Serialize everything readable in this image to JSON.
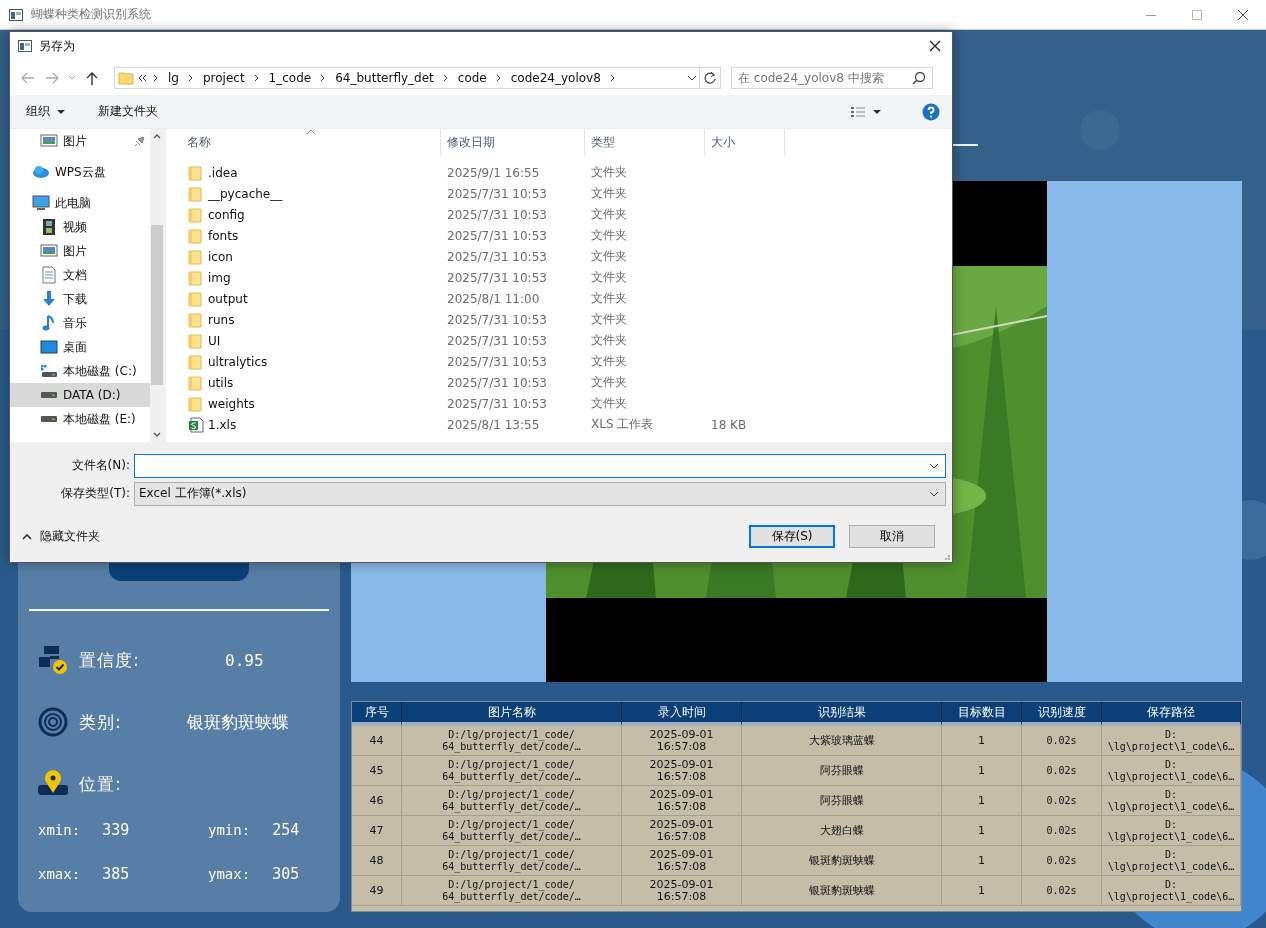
{
  "app": {
    "title": "蝴蝶种类检测识别系统"
  },
  "results": {
    "confidence_label": "置信度:",
    "confidence": "0.95",
    "class_label": "类别:",
    "class": "银斑豹斑蛱蝶",
    "position_label": "位置:",
    "coords": [
      {
        "label": "xmin:",
        "value": "339"
      },
      {
        "label": "ymin:",
        "value": "254"
      },
      {
        "label": "xmax:",
        "value": "385"
      },
      {
        "label": "ymax:",
        "value": "305"
      }
    ]
  },
  "table": {
    "columns": [
      "序号",
      "图片名称",
      "录入时间",
      "识别结果",
      "目标数目",
      "识别速度",
      "保存路径"
    ],
    "rows": [
      [
        "44",
        "D:/lg/project/1_code/\n64_butterfly_det/code/…",
        "2025-09-01\n16:57:08",
        "大紫玻璃蓝蝶",
        "1",
        "0.02s",
        "D:\n\\lg\\project\\1_code\\6…"
      ],
      [
        "45",
        "D:/lg/project/1_code/\n64_butterfly_det/code/…",
        "2025-09-01\n16:57:08",
        "阿芬眼蝶",
        "1",
        "0.02s",
        "D:\n\\lg\\project\\1_code\\6…"
      ],
      [
        "46",
        "D:/lg/project/1_code/\n64_butterfly_det/code/…",
        "2025-09-01\n16:57:08",
        "阿芬眼蝶",
        "1",
        "0.02s",
        "D:\n\\lg\\project\\1_code\\6…"
      ],
      [
        "47",
        "D:/lg/project/1_code/\n64_butterfly_det/code/…",
        "2025-09-01\n16:57:08",
        "大翅白蝶",
        "1",
        "0.02s",
        "D:\n\\lg\\project\\1_code\\6…"
      ],
      [
        "48",
        "D:/lg/project/1_code/\n64_butterfly_det/code/…",
        "2025-09-01\n16:57:08",
        "银斑豹斑蛱蝶",
        "1",
        "0.02s",
        "D:\n\\lg\\project\\1_code\\6…"
      ],
      [
        "49",
        "D:/lg/project/1_code/\n64_butterfly_det/code/…",
        "2025-09-01\n16:57:08",
        "银斑豹斑蛱蝶",
        "1",
        "0.02s",
        "D:\n\\lg\\project\\1_code\\6…"
      ]
    ]
  },
  "dialog": {
    "title": "另存为",
    "address": {
      "path": [
        "lg",
        "project",
        "1_code",
        "64_butterfly_det",
        "code",
        "code24_yolov8"
      ]
    },
    "search": {
      "placeholder": "在 code24_yolov8 中搜索"
    },
    "toolbar": {
      "organize": "组织",
      "new_folder": "新建文件夹"
    },
    "nav": [
      {
        "label": "图片",
        "kind": "pictures",
        "pinned": true,
        "selected": false
      },
      {
        "label": "WPS云盘",
        "kind": "cloud",
        "pinned": false,
        "selected": false
      },
      {
        "label": "此电脑",
        "kind": "pc",
        "pinned": false,
        "selected": false,
        "children": [
          {
            "label": "视频",
            "kind": "video",
            "selected": false
          },
          {
            "label": "图片",
            "kind": "pictures",
            "selected": false
          },
          {
            "label": "文档",
            "kind": "docs",
            "selected": false
          },
          {
            "label": "下载",
            "kind": "download",
            "selected": false
          },
          {
            "label": "音乐",
            "kind": "music",
            "selected": false
          },
          {
            "label": "桌面",
            "kind": "desktop",
            "selected": false
          },
          {
            "label": "本地磁盘 (C:)",
            "kind": "system-drive",
            "selected": false
          },
          {
            "label": "DATA (D:)",
            "kind": "drive",
            "selected": true
          },
          {
            "label": "本地磁盘 (E:)",
            "kind": "drive",
            "selected": false
          }
        ]
      }
    ],
    "columns": [
      "名称",
      "修改日期",
      "类型",
      "大小"
    ],
    "files": [
      {
        "name": ".idea",
        "date": "2025/9/1 16:55",
        "type": "文件夹",
        "kind": "folder"
      },
      {
        "name": "__pycache__",
        "date": "2025/7/31 10:53",
        "type": "文件夹",
        "kind": "folder"
      },
      {
        "name": "config",
        "date": "2025/7/31 10:53",
        "type": "文件夹",
        "kind": "folder"
      },
      {
        "name": "fonts",
        "date": "2025/7/31 10:53",
        "type": "文件夹",
        "kind": "folder"
      },
      {
        "name": "icon",
        "date": "2025/7/31 10:53",
        "type": "文件夹",
        "kind": "folder"
      },
      {
        "name": "img",
        "date": "2025/7/31 10:53",
        "type": "文件夹",
        "kind": "folder"
      },
      {
        "name": "output",
        "date": "2025/8/1 11:00",
        "type": "文件夹",
        "kind": "folder"
      },
      {
        "name": "runs",
        "date": "2025/7/31 10:53",
        "type": "文件夹",
        "kind": "folder"
      },
      {
        "name": "UI",
        "date": "2025/7/31 10:53",
        "type": "文件夹",
        "kind": "folder"
      },
      {
        "name": "ultralytics",
        "date": "2025/7/31 10:53",
        "type": "文件夹",
        "kind": "folder"
      },
      {
        "name": "utils",
        "date": "2025/7/31 10:53",
        "type": "文件夹",
        "kind": "folder"
      },
      {
        "name": "weights",
        "date": "2025/7/31 10:53",
        "type": "文件夹",
        "kind": "folder"
      },
      {
        "name": "1.xls",
        "date": "2025/8/1 13:55",
        "type": "XLS 工作表",
        "size": "18 KB",
        "kind": "xls"
      }
    ],
    "file_name": {
      "label": "文件名(N):"
    },
    "file_type": {
      "label": "保存类型(T):",
      "value": "Excel 工作簿(*.xls)"
    },
    "hide_folders": "隐藏文件夹",
    "buttons": [
      {
        "label": "保存(S)",
        "kind": "default"
      },
      {
        "label": "取消",
        "kind": "normal"
      }
    ]
  }
}
